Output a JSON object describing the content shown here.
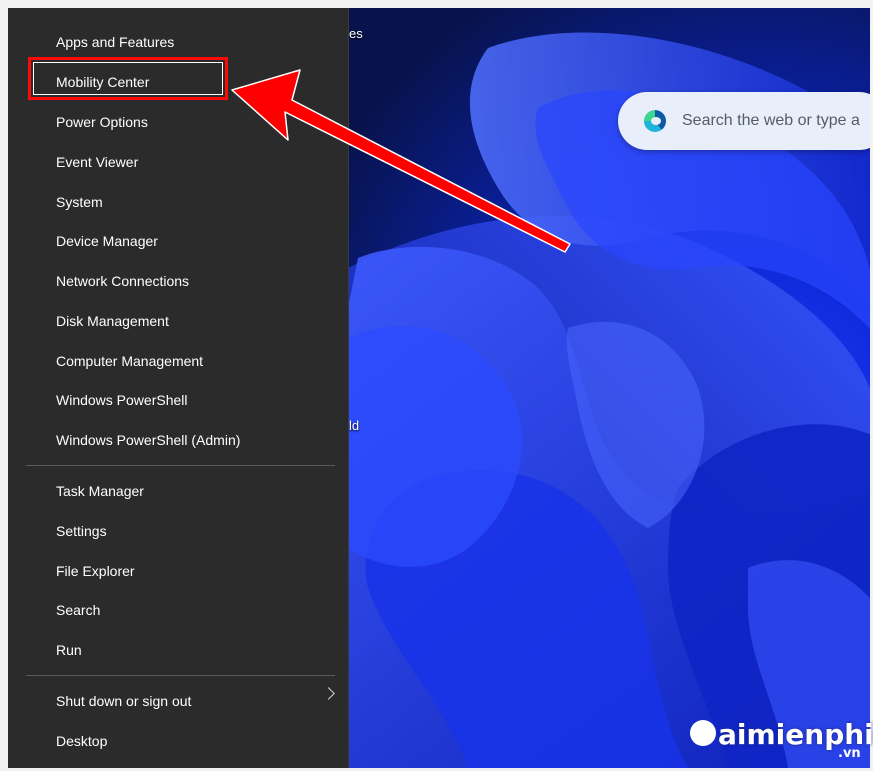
{
  "menu": {
    "group1": [
      {
        "label": "Apps and Features"
      },
      {
        "label": "Mobility Center"
      },
      {
        "label": "Power Options"
      },
      {
        "label": "Event Viewer"
      },
      {
        "label": "System"
      },
      {
        "label": "Device Manager"
      },
      {
        "label": "Network Connections"
      },
      {
        "label": "Disk Management"
      },
      {
        "label": "Computer Management"
      },
      {
        "label": "Windows PowerShell"
      },
      {
        "label": "Windows PowerShell (Admin)"
      }
    ],
    "group2": [
      {
        "label": "Task Manager"
      },
      {
        "label": "Settings"
      },
      {
        "label": "File Explorer"
      },
      {
        "label": "Search"
      },
      {
        "label": "Run"
      }
    ],
    "group3": [
      {
        "label": "Shut down or sign out"
      },
      {
        "label": "Desktop"
      }
    ]
  },
  "desktop": {
    "icon_label_top": "es",
    "icon_label_mid": "ld"
  },
  "search_bar": {
    "placeholder": "Search the web or type a",
    "icon": "edge-icon"
  },
  "watermark": {
    "brand": "aimienphi",
    "suffix": ".vn"
  },
  "colors": {
    "menu_bg": "#2b2b2b",
    "highlight": "#ff0a0a",
    "arrow": "#ff0000",
    "wallpaper": "#1c35ff"
  }
}
